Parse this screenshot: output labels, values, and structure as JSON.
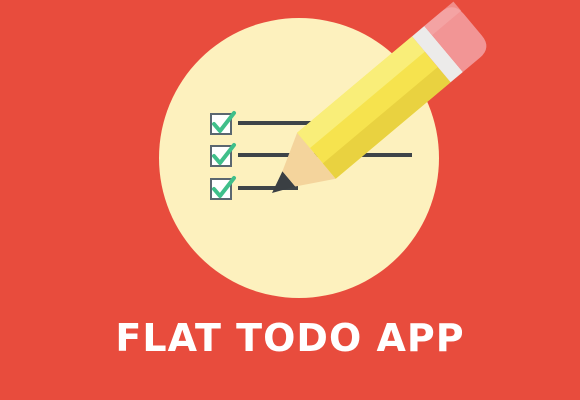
{
  "title": "FLAT TODO APP",
  "colors": {
    "background": "#E84C3D",
    "circle": "#FDF1BE",
    "checkmark": "#3FBF8A",
    "checkbox_border": "#5B6770",
    "list_line": "#3E4448",
    "pencil_body": "#F6E34E",
    "pencil_body_light": "#F9EE79",
    "pencil_body_shade": "#E9D240",
    "pencil_wood": "#F4D49C",
    "pencil_tip": "#3A3F43",
    "eraser": "#F29595",
    "ferrule": "#ECEBEA"
  },
  "icons": {
    "background_circle": "circle",
    "checklist": "checklist-icon",
    "pencil": "pencil-icon"
  },
  "checklist": {
    "items": [
      {
        "checked": true
      },
      {
        "checked": true
      },
      {
        "checked": true
      }
    ]
  }
}
